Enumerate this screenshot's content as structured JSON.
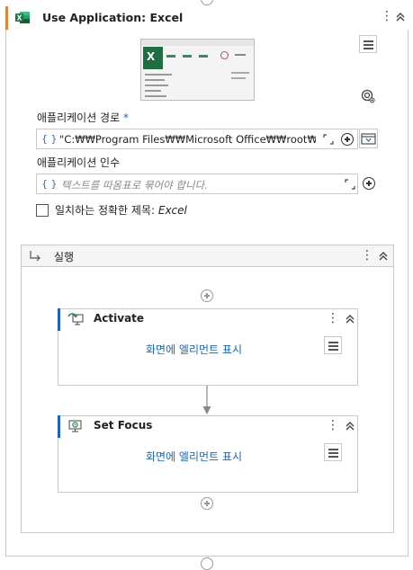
{
  "outer": {
    "title": "Use Application: Excel",
    "app_path_label": "애플리케이션 경로",
    "required_mark": "*",
    "app_path_value": "\"C:₩₩Program Files₩₩Microsoft Office₩₩root₩₩Of",
    "app_args_label": "애플리케이션 인수",
    "app_args_placeholder": "텍스트를 따옴표로 묶어야 합니다.",
    "exact_title_label": "일치하는 정확한 제목:",
    "exact_title_value": "Excel",
    "exact_title_checked": false,
    "brace_glyph": "{ }"
  },
  "do_block": {
    "title": "실행"
  },
  "activities": [
    {
      "title": "Activate",
      "link": "화면에 엘리먼트 표시",
      "icon": "activate-icon"
    },
    {
      "title": "Set Focus",
      "link": "화면에 엘리먼트 표시",
      "icon": "set-focus-icon"
    }
  ],
  "colors": {
    "accent_orange": "#e8833a",
    "accent_blue": "#1a63c6",
    "excel_green": "#1d6f42"
  }
}
